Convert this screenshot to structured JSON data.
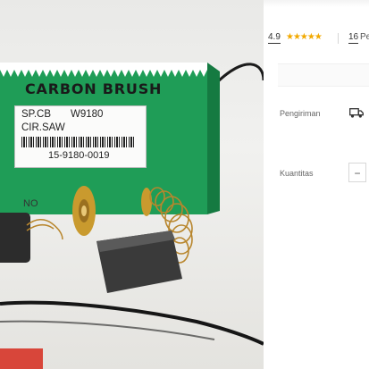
{
  "product_image": {
    "box_title": "CARBON BRUSH",
    "label_code": "SP.CB",
    "label_model": "W9180",
    "label_type": "CIR.SAW",
    "label_number": "15-9180-0019",
    "label_no": "NO"
  },
  "rating": {
    "value": "4.9",
    "stars_glyph": "★★★★★",
    "review_count": "16",
    "review_suffix": "Pe"
  },
  "shipping": {
    "label": "Pengiriman",
    "icon": "truck-icon"
  },
  "quantity": {
    "label": "Kuantitas",
    "decrement_label": "−"
  },
  "colors": {
    "box_green": "#1e9f57",
    "star": "#f2a900",
    "brush_block": "#3a3a3a",
    "spring": "#b8862d"
  }
}
